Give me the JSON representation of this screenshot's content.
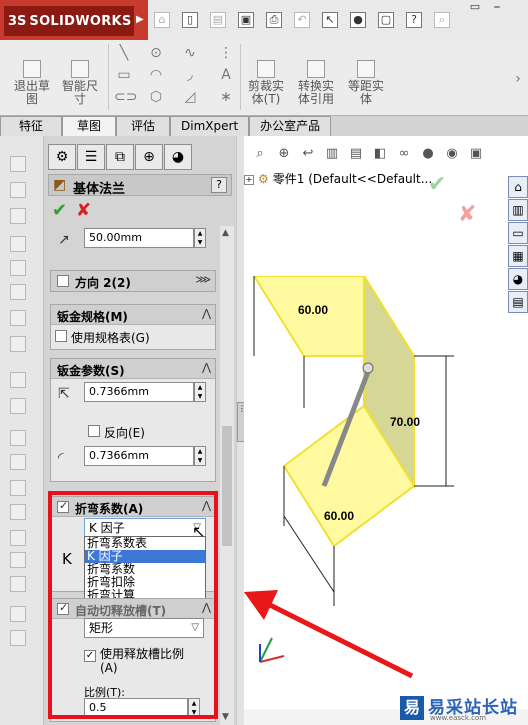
{
  "app": {
    "brand": "SOLIDWORKS",
    "ds_mark": "3S"
  },
  "command_manager": {
    "big_buttons": [
      {
        "label": "退出草\n图"
      },
      {
        "label": "智能尺\n寸"
      },
      {
        "label": "剪裁实\n体(T)"
      },
      {
        "label": "转换实\n体引用"
      },
      {
        "label": "等距实\n体"
      }
    ]
  },
  "tabs": [
    "特征",
    "草图",
    "评估",
    "DimXpert",
    "办公室产品"
  ],
  "active_tab": "草图",
  "property_manager": {
    "title": "基体法兰",
    "help": "?",
    "d1_value": "50.00mm",
    "direction2_label": "方向 2(2)",
    "sheet_gauge": {
      "header": "钣金规格(M)",
      "use_gauge_table": "使用规格表(G)"
    },
    "sheet_params": {
      "header": "钣金参数(S)",
      "t1_value": "0.7366mm",
      "reverse": "反向(E)",
      "radius_value": "0.7366mm"
    },
    "bend_allowance": {
      "header": "折弯系数(A)",
      "selected": "K 因子",
      "k_label": "K",
      "options": [
        "折弯系数表",
        "K 因子",
        "折弯系数",
        "折弯扣除",
        "折弯计算"
      ]
    },
    "auto_relief": {
      "header": "自动切释放槽(T)",
      "type": "矩形",
      "use_ratio": "使用释放槽比例\n(A)",
      "ratio_label": "比例(T):",
      "ratio_value": "0.5"
    }
  },
  "graphics": {
    "tree_item": "零件1  (Default<<Default..."
  },
  "model": {
    "dimensions": [
      "60.00",
      "70.00",
      "60.00"
    ]
  },
  "watermark": {
    "text": "易采站长站",
    "sub": "www.easck.com"
  },
  "colors": {
    "highlight": "#e8101a",
    "face": "#fffaa0",
    "edge": "#f0e030",
    "arrow": "#e81818"
  }
}
